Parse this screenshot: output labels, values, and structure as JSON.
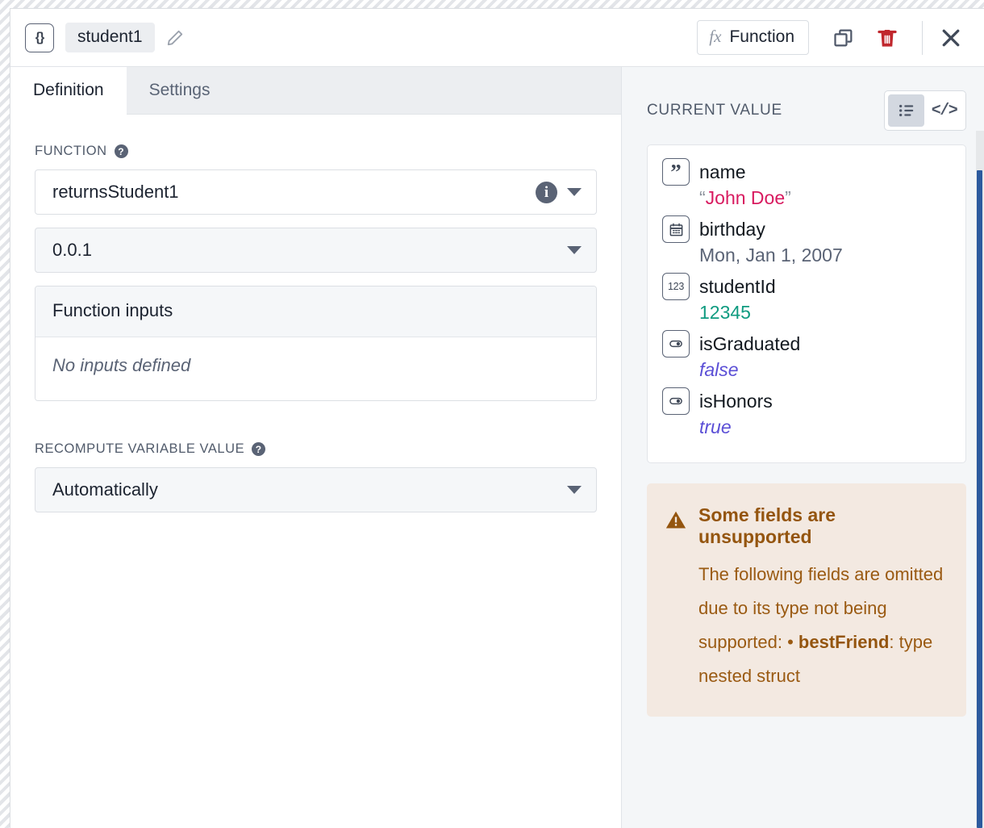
{
  "header": {
    "type_badge": "{}",
    "variable_name": "student1",
    "edit_icon": "pencil-icon",
    "function_button": {
      "fx": "fx",
      "label": "Function"
    },
    "copy_icon": "copy-icon",
    "delete_icon": "trash-icon",
    "close_icon": "close-icon"
  },
  "tabs": [
    {
      "label": "Definition",
      "active": true
    },
    {
      "label": "Settings",
      "active": false
    }
  ],
  "definition": {
    "function_label": "FUNCTION",
    "function_help_icon": "help-icon",
    "function_value": "returnsStudent1",
    "function_info_icon": "info-icon",
    "version_value": "0.0.1",
    "inputs_header": "Function inputs",
    "inputs_empty": "No inputs defined",
    "recompute_label": "RECOMPUTE VARIABLE VALUE",
    "recompute_help_icon": "help-icon",
    "recompute_value": "Automatically"
  },
  "current_value": {
    "title": "CURRENT VALUE",
    "view_toggle": [
      {
        "icon": "list-view-icon",
        "active": true
      },
      {
        "icon": "code-view-icon",
        "label": "</>",
        "active": false
      }
    ],
    "fields": [
      {
        "badge": "quote-icon",
        "name": "name",
        "value": "John Doe",
        "open_quote": "“",
        "close_quote": "”",
        "kind": "string"
      },
      {
        "badge": "calendar-icon",
        "name": "birthday",
        "value": "Mon, Jan 1, 2007",
        "kind": "date"
      },
      {
        "badge": "123",
        "name": "studentId",
        "value": "12345",
        "kind": "number"
      },
      {
        "badge": "toggle-icon",
        "name": "isGraduated",
        "value": "false",
        "kind": "boolean"
      },
      {
        "badge": "toggle-icon",
        "name": "isHonors",
        "value": "true",
        "kind": "boolean"
      }
    ]
  },
  "warning": {
    "icon": "warning-triangle-icon",
    "title": "Some fields are unsupported",
    "line1": "The following fields are omitted due to its type not being supported:",
    "bullet": "• ",
    "bullet_field": "bestFriend",
    "bullet_rest": ": type nested struct"
  },
  "colors": {
    "accent_string": "#d81b60",
    "accent_number": "#0f9b80",
    "accent_boolean": "#5b4fd6",
    "warning_text": "#94550f",
    "warning_bg": "#f3e9e1",
    "delete": "#c0272d",
    "scrollbar_thumb": "#2c5a9e"
  }
}
